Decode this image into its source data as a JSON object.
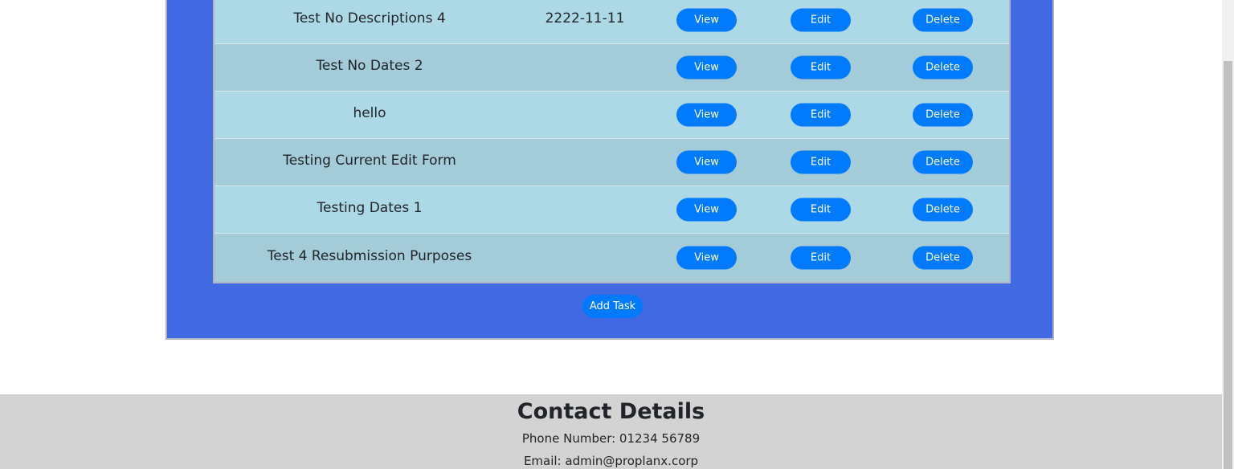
{
  "tasks": {
    "rows": [
      {
        "name": "Test No Descriptions 4",
        "date": "2222-11-11",
        "view": "View",
        "edit": "Edit",
        "delete": "Delete"
      },
      {
        "name": "Test No Dates 2",
        "date": "",
        "view": "View",
        "edit": "Edit",
        "delete": "Delete"
      },
      {
        "name": "hello",
        "date": "",
        "view": "View",
        "edit": "Edit",
        "delete": "Delete"
      },
      {
        "name": "Testing Current Edit Form",
        "date": "",
        "view": "View",
        "edit": "Edit",
        "delete": "Delete"
      },
      {
        "name": "Testing Dates 1",
        "date": "",
        "view": "View",
        "edit": "Edit",
        "delete": "Delete"
      },
      {
        "name": "Test 4 Resubmission Purposes",
        "date": "",
        "view": "View",
        "edit": "Edit",
        "delete": "Delete"
      }
    ],
    "add_label": "Add Task"
  },
  "footer": {
    "heading": "Contact Details",
    "phone": "Phone Number: 01234 56789",
    "email": "Email: admin@proplanx.corp"
  },
  "colors": {
    "panel": "#4169e1",
    "row_light": "#add8e6",
    "row_dark": "#a3cbd8",
    "button": "#007bff",
    "footer": "#d3d3d3"
  }
}
